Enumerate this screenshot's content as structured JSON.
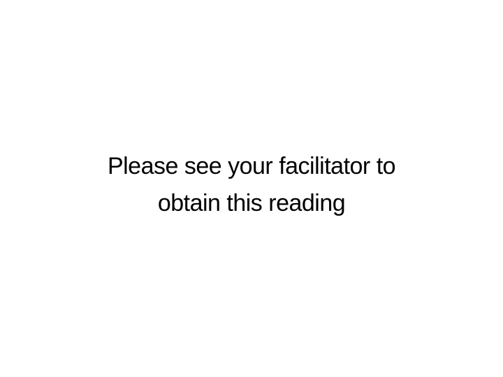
{
  "slide": {
    "title_lines": [
      "Please see your facilitator to",
      "obtain this reading"
    ]
  }
}
